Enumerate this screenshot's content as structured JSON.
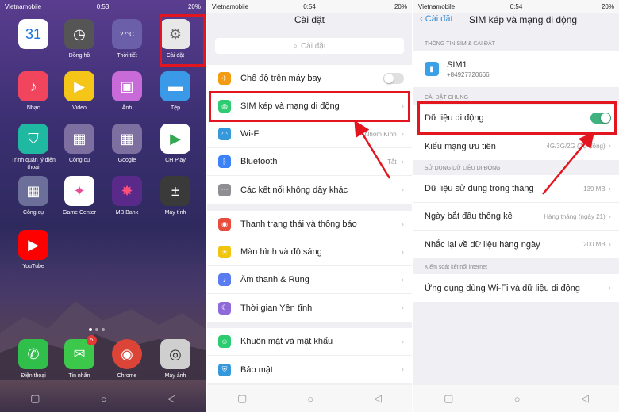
{
  "home": {
    "status": {
      "carrier": "Vietnamobile",
      "time": "0:53",
      "battery": "20%"
    },
    "apps": [
      {
        "label": "",
        "icon": "calendar-icon",
        "glyph": "31",
        "bg": "#ffffff",
        "fg": "#1a73e8"
      },
      {
        "label": "Đồng hồ",
        "icon": "clock-icon",
        "glyph": "◷",
        "bg": "#555555",
        "fg": "#ffffff"
      },
      {
        "label": "Thời tiết",
        "icon": "weather-icon",
        "glyph": "27°C",
        "bg": "#6a5fa8",
        "fg": "#ffffff"
      },
      {
        "label": "Cài đặt",
        "icon": "settings-gear-icon",
        "glyph": "⚙",
        "bg": "#e8e8e8",
        "fg": "#666666"
      },
      {
        "label": "Nhạc",
        "icon": "music-icon",
        "glyph": "♪",
        "bg": "#f0455d",
        "fg": "#ffffff"
      },
      {
        "label": "Video",
        "icon": "video-icon",
        "glyph": "▶",
        "bg": "#f5c518",
        "fg": "#ffffff"
      },
      {
        "label": "Ảnh",
        "icon": "photos-icon",
        "glyph": "▣",
        "bg": "#c86ad8",
        "fg": "#ffffff"
      },
      {
        "label": "Tệp",
        "icon": "files-icon",
        "glyph": "▬",
        "bg": "#3a9ae8",
        "fg": "#ffffff"
      },
      {
        "label": "Trình quản lý điện thoại",
        "icon": "phone-manager-icon",
        "glyph": "⛉",
        "bg": "#1fb8a0",
        "fg": "#ffffff"
      },
      {
        "label": "Công cụ",
        "icon": "tools-folder-icon",
        "glyph": "▦",
        "bg": "#7d6fa0",
        "fg": "#ffffff"
      },
      {
        "label": "Google",
        "icon": "google-folder-icon",
        "glyph": "▦",
        "bg": "#7d6fa0",
        "fg": "#ffffff"
      },
      {
        "label": "CH Play",
        "icon": "play-store-icon",
        "glyph": "▶",
        "bg": "#ffffff",
        "fg": "#34a853"
      },
      {
        "label": "Công cụ",
        "icon": "tools-folder-2-icon",
        "glyph": "▦",
        "bg": "#6b6f9a",
        "fg": "#ffffff"
      },
      {
        "label": "Game Center",
        "icon": "game-center-icon",
        "glyph": "✦",
        "bg": "#ffffff",
        "fg": "#e84a9a"
      },
      {
        "label": "MB Bank",
        "icon": "mb-bank-icon",
        "glyph": "✸",
        "bg": "#5a2a8a",
        "fg": "#ff4f7a"
      },
      {
        "label": "Máy tính",
        "icon": "calculator-icon",
        "glyph": "±",
        "bg": "#3a3a3a",
        "fg": "#ffffff"
      },
      {
        "label": "YouTube",
        "icon": "youtube-icon",
        "glyph": "▶",
        "bg": "#ff0000",
        "fg": "#ffffff"
      }
    ],
    "dock": [
      {
        "label": "Điện thoại",
        "icon": "phone-icon",
        "glyph": "✆",
        "bg": "#2fbf4a",
        "fg": "#ffffff"
      },
      {
        "label": "Tin nhắn",
        "icon": "messages-icon",
        "glyph": "✉",
        "bg": "#3cc84b",
        "fg": "#ffffff",
        "badge": "5"
      },
      {
        "label": "Chrome",
        "icon": "chrome-icon",
        "glyph": "◉",
        "bg": "#db4437",
        "fg": "#ffffff"
      },
      {
        "label": "Máy ảnh",
        "icon": "camera-icon",
        "glyph": "◎",
        "bg": "#cfcfcf",
        "fg": "#333333"
      }
    ]
  },
  "settings": {
    "status": {
      "carrier": "Vietnamobile",
      "time": "0:54",
      "battery": "20%"
    },
    "title": "Cài đặt",
    "search_placeholder": "Cài đặt",
    "group1": [
      {
        "label": "Chế độ trên máy bay",
        "icon": "airplane-icon",
        "glyph": "✈",
        "color": "#f39c12",
        "value": "",
        "toggle": true
      },
      {
        "label": "SIM kép và mạng di động",
        "icon": "sim-network-icon",
        "glyph": "◍",
        "color": "#2ecc71",
        "value": ""
      },
      {
        "label": "Wi-Fi",
        "icon": "wifi-icon",
        "glyph": "◠",
        "color": "#3498db",
        "value": "Nhóm Kính"
      },
      {
        "label": "Bluetooth",
        "icon": "bluetooth-icon",
        "glyph": "ᛒ",
        "color": "#3b82f6",
        "value": "Tắt"
      },
      {
        "label": "Các kết nối không dây khác",
        "icon": "more-connections-icon",
        "glyph": "⋯",
        "color": "#8e8e93",
        "value": ""
      }
    ],
    "group2": [
      {
        "label": "Thanh trạng thái và thông báo",
        "icon": "notification-icon",
        "glyph": "◉",
        "color": "#e74c3c"
      },
      {
        "label": "Màn hình và độ sáng",
        "icon": "display-icon",
        "glyph": "☀",
        "color": "#f1c40f"
      },
      {
        "label": "Âm thanh & Rung",
        "icon": "sound-icon",
        "glyph": "♪",
        "color": "#5b7cf0"
      },
      {
        "label": "Thời gian Yên tĩnh",
        "icon": "quiet-time-icon",
        "glyph": "☾",
        "color": "#8e6bd8"
      }
    ],
    "group3": [
      {
        "label": "Khuôn mặt và mật khẩu",
        "icon": "face-password-icon",
        "glyph": "☺",
        "color": "#2ecc71"
      },
      {
        "label": "Bảo mật",
        "icon": "security-icon",
        "glyph": "⛨",
        "color": "#3498db"
      }
    ]
  },
  "sim": {
    "status": {
      "carrier": "Vietnamobile",
      "time": "0:54",
      "battery": "20%"
    },
    "back_label": "Cài đặt",
    "title": "SIM kép và mạng di động",
    "section_sim": "THÔNG TIN SIM & CÀI ĐẶT",
    "sim1_name": "SIM1",
    "sim1_number": "+84927720666",
    "section_general": "CÀI ĐẶT CHUNG",
    "mobile_data": "Dữ liệu di động",
    "network_type": "Kiểu mạng ưu tiên",
    "network_type_value": "4G/3G/2G (Tự động)",
    "section_usage": "SỬ DỤNG DỮ LIỆU DI ĐỘNG",
    "usage_rows": [
      {
        "label": "Dữ liệu sử dụng trong tháng",
        "value": "139 MB"
      },
      {
        "label": "Ngày bắt đầu thống kê",
        "value": "Hàng tháng (ngày 21)"
      },
      {
        "label": "Nhắc lại về dữ liệu hàng ngày",
        "value": "200 MB"
      }
    ],
    "section_internet": "Kiểm soát kết nối internet",
    "apps_wifi_data": "Ứng dụng dùng Wi-Fi và dữ liệu di động"
  },
  "colors": {
    "highlight": "#e3151f",
    "toggle_on": "#3fb27f",
    "link": "#3a8fd9"
  }
}
